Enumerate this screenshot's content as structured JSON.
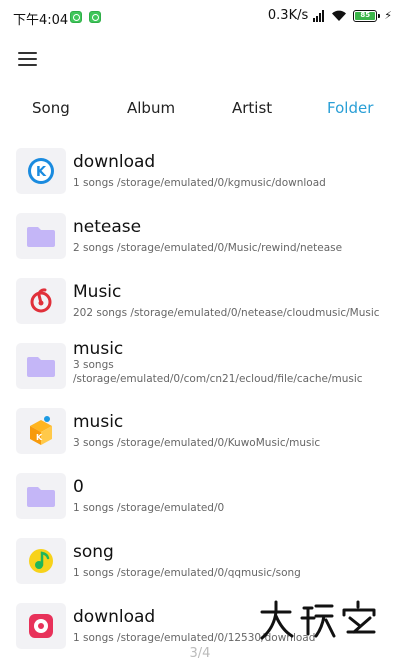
{
  "status_bar": {
    "time": "下午4:04",
    "net_speed": "0.3K/s",
    "battery_level": "85",
    "battery_color": "#3cb54a"
  },
  "menu": {
    "icon": "hamburger-menu-icon"
  },
  "tabs": [
    {
      "label": "Song",
      "active": false
    },
    {
      "label": "Album",
      "active": false
    },
    {
      "label": "Artist",
      "active": false
    },
    {
      "label": "Folder",
      "active": true
    }
  ],
  "accent_color": "#2a9fd6",
  "folders": [
    {
      "name": "download",
      "meta": "1 songs /storage/emulated/0/kgmusic/download",
      "icon": "kugou-music-icon"
    },
    {
      "name": "netease",
      "meta": "2 songs /storage/emulated/0/Music/rewind/netease",
      "icon": "folder-icon"
    },
    {
      "name": "Music",
      "meta": "202 songs /storage/emulated/0/netease/cloudmusic/Music",
      "icon": "netease-cloud-music-icon"
    },
    {
      "name": "music",
      "meta": "3 songs /storage/emulated/0/com/cn21/ecloud/file/cache/music",
      "icon": "folder-icon"
    },
    {
      "name": "music",
      "meta": "3 songs /storage/emulated/0/KuwoMusic/music",
      "icon": "kuwo-music-icon"
    },
    {
      "name": "0",
      "meta": "1 songs /storage/emulated/0",
      "icon": "folder-icon"
    },
    {
      "name": "song",
      "meta": "1 songs /storage/emulated/0/qqmusic/song",
      "icon": "qq-music-icon"
    },
    {
      "name": "download",
      "meta": "1 songs /storage/emulated/0/12530/download",
      "icon": "migu-music-icon"
    }
  ],
  "watermark": "大玩客",
  "page_indicator": "3/4"
}
